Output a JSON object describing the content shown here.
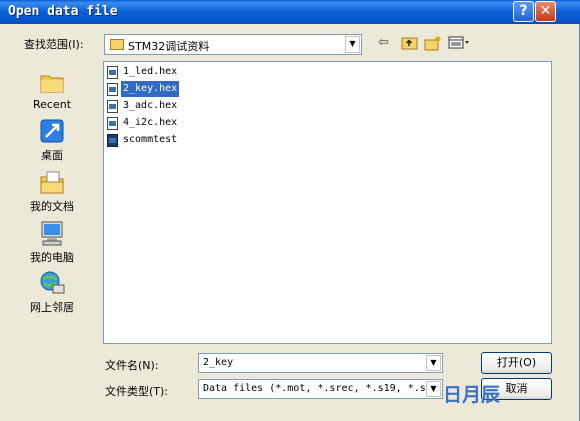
{
  "window": {
    "title": "Open data file",
    "help_glyph": "?",
    "close_glyph": "✕"
  },
  "lookin": {
    "label": "查找范围(I):",
    "value": "STM32调试资料",
    "icons": [
      "back-arrow-icon",
      "up-folder-icon",
      "new-folder-icon",
      "view-menu-icon"
    ]
  },
  "places": [
    {
      "label": "Recent",
      "icon": "recent-folder-icon"
    },
    {
      "label": "桌面",
      "icon": "desktop-icon"
    },
    {
      "label": "我的文档",
      "icon": "my-documents-icon"
    },
    {
      "label": "我的电脑",
      "icon": "my-computer-icon"
    },
    {
      "label": "网上邻居",
      "icon": "network-places-icon"
    }
  ],
  "files": [
    {
      "name": "1_led.hex",
      "type": "hex",
      "selected": false
    },
    {
      "name": "2_key.hex",
      "type": "hex",
      "selected": true
    },
    {
      "name": "3_adc.hex",
      "type": "hex",
      "selected": false
    },
    {
      "name": "4_i2c.hex",
      "type": "hex",
      "selected": false
    },
    {
      "name": "scommtest",
      "type": "app",
      "selected": false
    }
  ],
  "filename": {
    "label": "文件名(N):",
    "value": "2_key"
  },
  "filetype": {
    "label": "文件类型(T):",
    "value": "Data files (*.mot, *.srec, *.s19, *.s"
  },
  "buttons": {
    "open": "打开(O)",
    "cancel": "取消"
  },
  "watermark": "日月辰",
  "colors": {
    "titlebar": "#0a5fd8",
    "selection": "#316ac5",
    "field_border": "#7f9db9"
  }
}
